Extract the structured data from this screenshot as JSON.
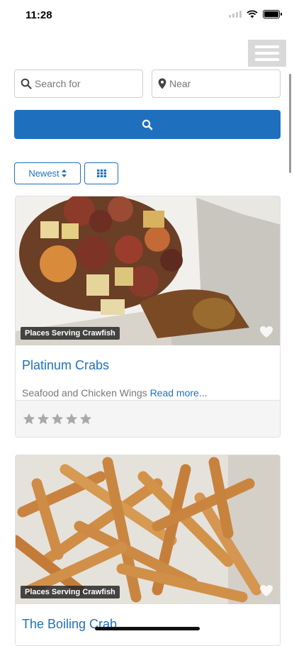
{
  "status": {
    "time": "11:28"
  },
  "search": {
    "query_placeholder": "Search for",
    "near_placeholder": "Near"
  },
  "controls": {
    "sort_label": "Newest"
  },
  "listings": [
    {
      "tag": "Places Serving Crawfish",
      "name": "Platinum Crabs",
      "description": "Seafood and Chicken Wings",
      "read_more": "Read more...",
      "rating": 0
    },
    {
      "tag": "Places Serving Crawfish",
      "name": "The Boiling Crab"
    }
  ],
  "colors": {
    "accent": "#1f6fbf",
    "menu_bg": "#d9d9d9"
  },
  "icons": [
    "search-icon",
    "location-pin-icon",
    "sort-icon",
    "grid-icon",
    "heart-icon",
    "star-icon",
    "menu-icon"
  ]
}
